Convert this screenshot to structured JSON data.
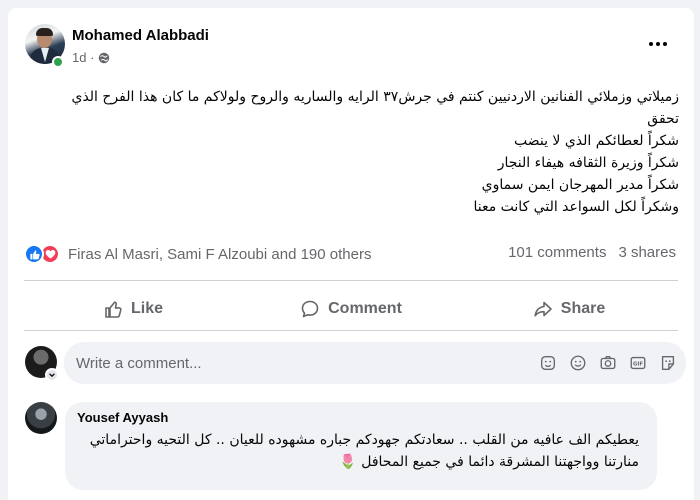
{
  "post": {
    "author": "Mohamed Alabbadi",
    "time": "1d ·",
    "privacy_icon": "globe-icon",
    "body_lines": [
      "زميلاتي وزملائي الفنانين الاردنيين كنتم في جرش٣٧ الرايه والساريه والروح ولولاكم ما كان هذا الفرح الذي",
      "تحقق",
      "شكراً لعطائكم الذي لا ينضب",
      "شكراً  وزيرة الثقافه هيفاء النجار",
      "شكراً مدير المهرجان ايمن سماوي",
      "وشكراً لكل السواعد التي كانت معنا"
    ]
  },
  "reactions": {
    "names": "Firas Al Masri, Sami F Alzoubi and 190 others",
    "comments": "101 comments",
    "shares": "3 shares"
  },
  "actions": {
    "like": "Like",
    "comment": "Comment",
    "share": "Share"
  },
  "composer": {
    "placeholder": "Write a comment..."
  },
  "comment": {
    "author": "Yousef Ayyash",
    "text": "يعطيكم الف عافيه من القلب .. سعادتكم جهودكم جباره مشهوده للعيان .. كل التحيه واحتراماتي منارتنا وواجهتنا المشرقة دائما في جميع المحافل 🌷"
  },
  "colors": {
    "like_blue": "#1877f2",
    "love_red": "#f33e58",
    "online_green": "#31a24c"
  }
}
